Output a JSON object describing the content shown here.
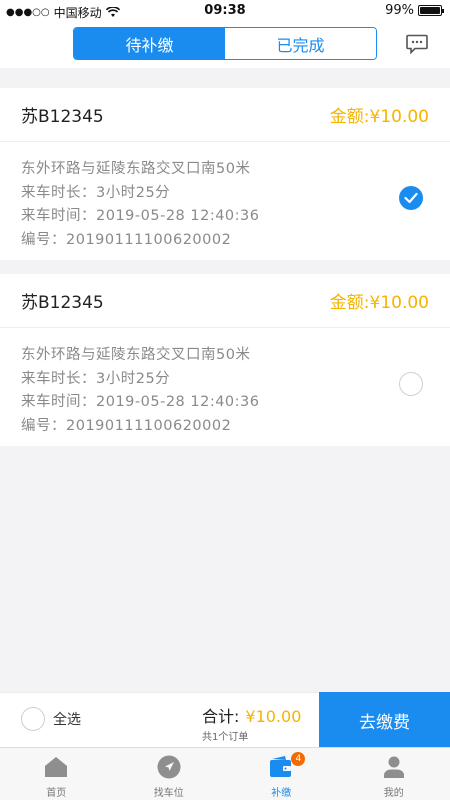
{
  "status_bar": {
    "carrier": "中国移动",
    "time": "09:38",
    "battery": "99%",
    "battery_level": 0.99
  },
  "header": {
    "tabs": [
      {
        "label": "待补缴",
        "active": true
      },
      {
        "label": "已完成",
        "active": false
      }
    ],
    "message_icon": "chat-bubble-icon"
  },
  "orders": [
    {
      "plate": "苏B12345",
      "amount": "金额:¥10.00",
      "address": "东外环路与延陵东路交叉口南50米",
      "duration": "来车时长：3小时25分",
      "arrival_time": "来车时间：2019-05-28 12:40:36",
      "order_no": "编号：20190111100620002",
      "selected": true
    },
    {
      "plate": "苏B12345",
      "amount": "金额:¥10.00",
      "address": "东外环路与延陵东路交叉口南50米",
      "duration": "来车时长：3小时25分",
      "arrival_time": "来车时间：2019-05-28 12:40:36",
      "order_no": "编号：20190111100620002",
      "selected": false
    }
  ],
  "action_bar": {
    "select_all_label": "全选",
    "total_label": "合计:",
    "total_amount": "¥10.00",
    "total_count": "共1个订单",
    "pay_button": "去缴费"
  },
  "tab_bar": {
    "tabs": [
      {
        "label": "首页",
        "icon": "home-icon"
      },
      {
        "label": "找车位",
        "icon": "navigate-icon"
      },
      {
        "label": "补缴",
        "icon": "wallet-icon",
        "badge": "4",
        "active": true
      },
      {
        "label": "我的",
        "icon": "user-icon"
      }
    ]
  },
  "colors": {
    "accent": "#1a8cf0",
    "amount": "#f4b400",
    "badge": "#f56a00"
  }
}
